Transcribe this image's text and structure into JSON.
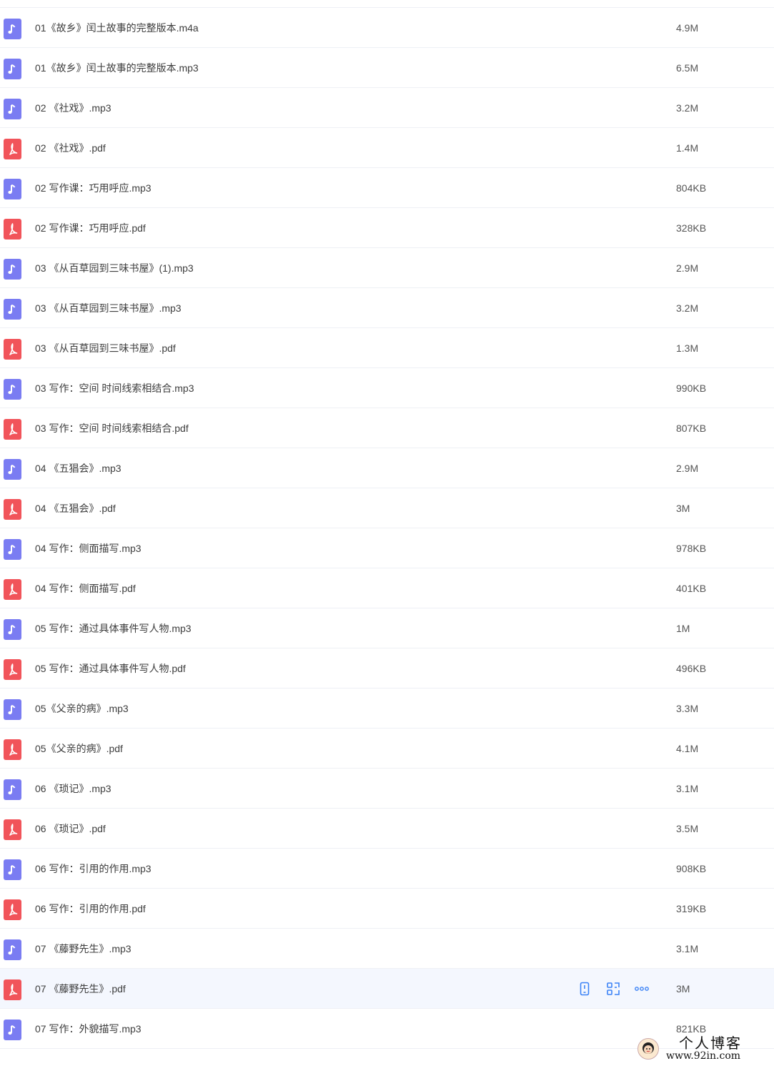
{
  "files": [
    {
      "name": "01《故乡》闰土故事的完整版本.m4a",
      "size": "4.9M",
      "type": "audio"
    },
    {
      "name": "01《故乡》闰土故事的完整版本.mp3",
      "size": "6.5M",
      "type": "audio"
    },
    {
      "name": "02 《社戏》.mp3",
      "size": "3.2M",
      "type": "audio"
    },
    {
      "name": "02 《社戏》.pdf",
      "size": "1.4M",
      "type": "pdf"
    },
    {
      "name": "02 写作课：巧用呼应.mp3",
      "size": "804KB",
      "type": "audio"
    },
    {
      "name": "02 写作课：巧用呼应.pdf",
      "size": "328KB",
      "type": "pdf"
    },
    {
      "name": "03 《从百草园到三味书屋》(1).mp3",
      "size": "2.9M",
      "type": "audio"
    },
    {
      "name": "03 《从百草园到三味书屋》.mp3",
      "size": "3.2M",
      "type": "audio"
    },
    {
      "name": "03 《从百草园到三味书屋》.pdf",
      "size": "1.3M",
      "type": "pdf"
    },
    {
      "name": "03 写作：空间 时间线索相结合.mp3",
      "size": "990KB",
      "type": "audio"
    },
    {
      "name": "03 写作：空间 时间线索相结合.pdf",
      "size": "807KB",
      "type": "pdf"
    },
    {
      "name": "04 《五猖会》.mp3",
      "size": "2.9M",
      "type": "audio"
    },
    {
      "name": "04 《五猖会》.pdf",
      "size": "3M",
      "type": "pdf"
    },
    {
      "name": "04 写作：侧面描写.mp3",
      "size": "978KB",
      "type": "audio"
    },
    {
      "name": "04 写作：侧面描写.pdf",
      "size": "401KB",
      "type": "pdf"
    },
    {
      "name": "05 写作：通过具体事件写人物.mp3",
      "size": "1M",
      "type": "audio"
    },
    {
      "name": "05 写作：通过具体事件写人物.pdf",
      "size": "496KB",
      "type": "pdf"
    },
    {
      "name": "05《父亲的病》.mp3",
      "size": "3.3M",
      "type": "audio"
    },
    {
      "name": "05《父亲的病》.pdf",
      "size": "4.1M",
      "type": "pdf"
    },
    {
      "name": "06 《琐记》.mp3",
      "size": "3.1M",
      "type": "audio"
    },
    {
      "name": "06 《琐记》.pdf",
      "size": "3.5M",
      "type": "pdf"
    },
    {
      "name": "06 写作：引用的作用.mp3",
      "size": "908KB",
      "type": "audio"
    },
    {
      "name": "06 写作：引用的作用.pdf",
      "size": "319KB",
      "type": "pdf"
    },
    {
      "name": "07 《藤野先生》.mp3",
      "size": "3.1M",
      "type": "audio"
    },
    {
      "name": "07 《藤野先生》.pdf",
      "size": "3M",
      "type": "pdf",
      "hovered": true
    },
    {
      "name": "07 写作：外貌描写.mp3",
      "size": "821KB",
      "type": "audio"
    }
  ],
  "row_actions": [
    "phone-icon",
    "qr-share-icon",
    "more-icon"
  ],
  "colors": {
    "audio_icon": "#7a7cf2",
    "pdf_icon": "#f1545a",
    "action_icon": "#3b82f6",
    "hover_row": "#f4f7fe"
  },
  "watermark": {
    "title": "个人博客",
    "url": "www.92in.com"
  }
}
